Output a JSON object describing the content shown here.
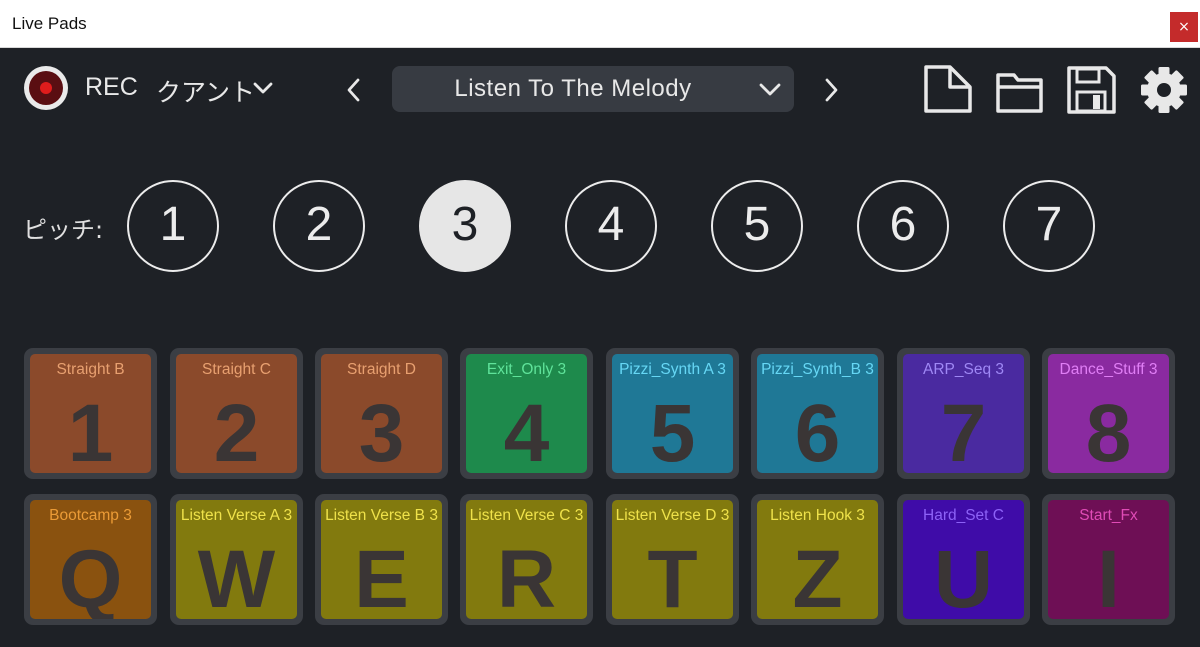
{
  "window": {
    "title": "Live Pads",
    "close_glyph": "×"
  },
  "toolbar": {
    "rec_label": "REC",
    "quantize_label": "クアント",
    "song_name": "Listen To The Melody",
    "icons": [
      "new-file-icon",
      "open-folder-icon",
      "save-icon",
      "settings-gear-icon"
    ]
  },
  "pitch": {
    "label": "ピッチ:",
    "buttons": [
      "1",
      "2",
      "3",
      "4",
      "5",
      "6",
      "7"
    ],
    "active": "3"
  },
  "pads": {
    "row1": [
      {
        "name": "Straight B",
        "key": "1",
        "bg": "#8b4a2b",
        "text": "#e8a070"
      },
      {
        "name": "Straight C",
        "key": "2",
        "bg": "#8b4a2b",
        "text": "#e8a070"
      },
      {
        "name": "Straight D",
        "key": "3",
        "bg": "#8b4a2b",
        "text": "#e8a070"
      },
      {
        "name": "Exit_Only 3",
        "key": "4",
        "bg": "#1e8a4c",
        "text": "#5fe39a"
      },
      {
        "name": "Pizzi_Synth A 3",
        "key": "5",
        "bg": "#1f7896",
        "text": "#66d7f5"
      },
      {
        "name": "Pizzi_Synth_B 3",
        "key": "6",
        "bg": "#1f7896",
        "text": "#66d7f5"
      },
      {
        "name": "ARP_Seq 3",
        "key": "7",
        "bg": "#4a2aa0",
        "text": "#9f88f5"
      },
      {
        "name": "Dance_Stuff 3",
        "key": "8",
        "bg": "#8a2aa0",
        "text": "#e07ef5"
      }
    ],
    "row2": [
      {
        "name": "Bootcamp 3",
        "key": "Q",
        "bg": "#8a520f",
        "text": "#eb9b36"
      },
      {
        "name": "Listen Verse A 3",
        "key": "W",
        "bg": "#827a0e",
        "text": "#efe24a"
      },
      {
        "name": "Listen Verse B 3",
        "key": "E",
        "bg": "#827a0e",
        "text": "#efe24a"
      },
      {
        "name": "Listen Verse C 3",
        "key": "R",
        "bg": "#827a0e",
        "text": "#efe24a"
      },
      {
        "name": "Listen Verse D 3",
        "key": "T",
        "bg": "#827a0e",
        "text": "#efe24a"
      },
      {
        "name": "Listen Hook 3",
        "key": "Z",
        "bg": "#827a0e",
        "text": "#efe24a"
      },
      {
        "name": "Hard_Set C",
        "key": "U",
        "bg": "#3f0ca8",
        "text": "#8d62f7"
      },
      {
        "name": "Start_Fx",
        "key": "I",
        "bg": "#6e0f55",
        "text": "#e04bb6"
      }
    ]
  }
}
